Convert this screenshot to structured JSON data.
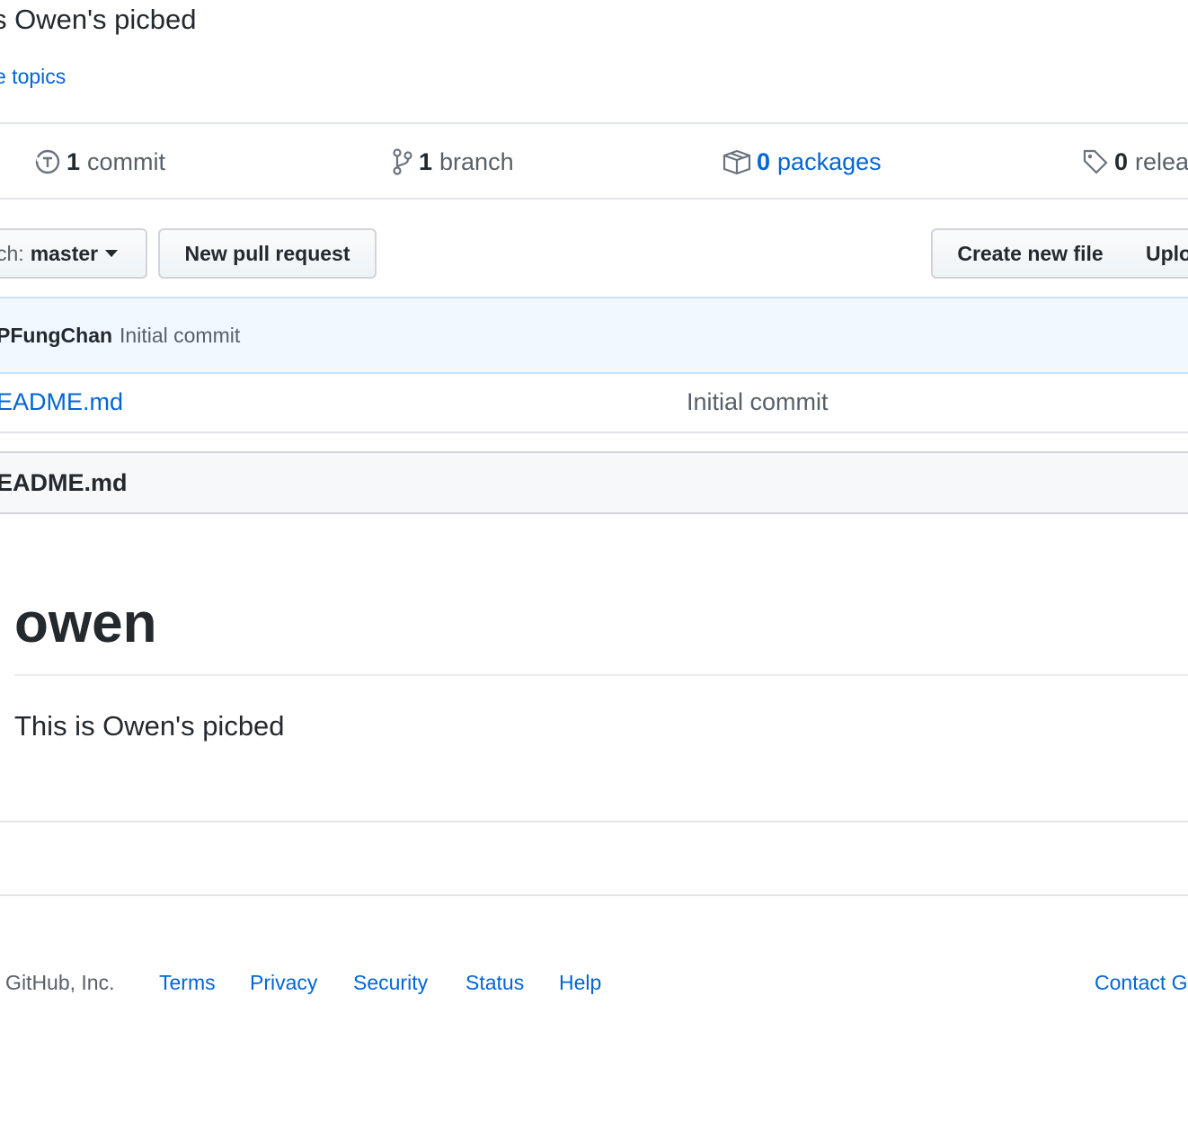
{
  "repo": {
    "description": "s Owen's picbed",
    "topics_link": "e topics"
  },
  "numbers": {
    "commits": {
      "count": "1",
      "label": "commit"
    },
    "branches": {
      "count": "1",
      "label": "branch"
    },
    "packages": {
      "count": "0",
      "label": "packages"
    },
    "releases": {
      "count": "0",
      "label": "relea"
    }
  },
  "toolbar": {
    "branch_prefix": "ch:",
    "branch_name": "master",
    "new_pr_label": "New pull request",
    "create_file_label": "Create new file",
    "upload_label": "Uplo"
  },
  "latest_commit": {
    "author": "PFungChan",
    "message": "Initial commit"
  },
  "files": [
    {
      "name": "EADME.md",
      "commit_message": "Initial commit"
    }
  ],
  "readme": {
    "header": "EADME.md",
    "heading": "owen",
    "paragraph": "This is Owen's picbed"
  },
  "footer": {
    "copyright": ") GitHub, Inc.",
    "links": [
      "Terms",
      "Privacy",
      "Security",
      "Status",
      "Help"
    ],
    "contact": "Contact G"
  },
  "colors": {
    "link": "#0366d6",
    "commit_bar_bg": "#f1f8ff",
    "readme_header_bg": "#f6f8fa"
  }
}
